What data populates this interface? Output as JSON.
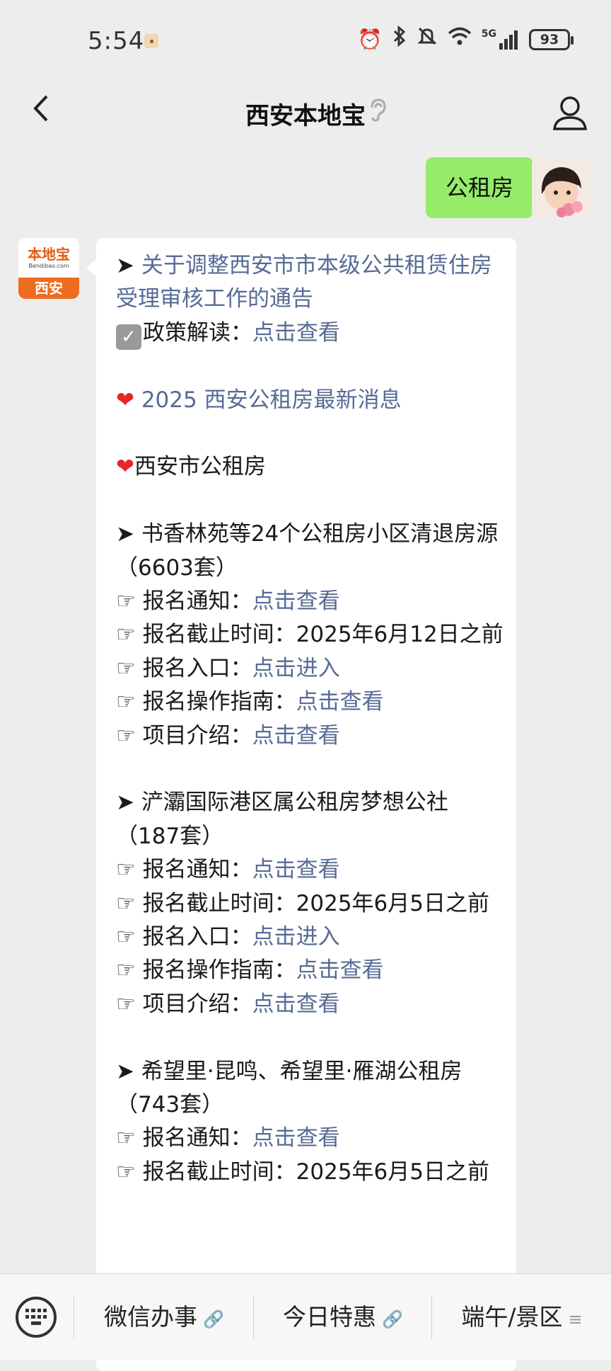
{
  "status_bar": {
    "time": "5:54",
    "network": "5G",
    "battery": "93"
  },
  "nav": {
    "title": "西安本地宝"
  },
  "chat": {
    "outgoing_text": "公租房",
    "bot_logo": {
      "name": "本地宝",
      "url": "Bendibao.com",
      "city": "西安"
    },
    "incoming": {
      "lines": [
        {
          "parts": [
            {
              "text": "➤ ",
              "style": "plain"
            },
            {
              "text": "关于调整西安市市本级公共租赁住房受理审核工作的通告",
              "style": "link"
            }
          ]
        },
        {
          "icon": "check",
          "parts": [
            {
              "text": "政策解读：",
              "style": "plain"
            },
            {
              "text": "点击查看",
              "style": "link"
            }
          ]
        },
        {
          "blank": true
        },
        {
          "icon": "heart",
          "parts": [
            {
              "text": " 2025 西安公租房最新消息",
              "style": "link"
            }
          ]
        },
        {
          "blank": true
        },
        {
          "icon": "heart",
          "parts": [
            {
              "text": "西安市公租房",
              "style": "plain"
            }
          ]
        },
        {
          "blank": true
        },
        {
          "parts": [
            {
              "text": "➤ 书香林苑等24个公租房小区清退房源（6603套）",
              "style": "plain"
            }
          ]
        },
        {
          "parts": [
            {
              "text": "☞ 报名通知：",
              "style": "plain"
            },
            {
              "text": "点击查看",
              "style": "link"
            }
          ]
        },
        {
          "parts": [
            {
              "text": "☞ 报名截止时间：2025年6月12日之前",
              "style": "plain"
            }
          ]
        },
        {
          "parts": [
            {
              "text": "☞ 报名入口：",
              "style": "plain"
            },
            {
              "text": "点击进入",
              "style": "link"
            }
          ]
        },
        {
          "parts": [
            {
              "text": "☞ 报名操作指南：",
              "style": "plain"
            },
            {
              "text": "点击查看",
              "style": "link"
            }
          ]
        },
        {
          "parts": [
            {
              "text": "☞ 项目介绍：",
              "style": "plain"
            },
            {
              "text": "点击查看",
              "style": "link"
            }
          ]
        },
        {
          "blank": true
        },
        {
          "parts": [
            {
              "text": "➤ 浐灞国际港区属公租房梦想公社（187套）",
              "style": "plain"
            }
          ]
        },
        {
          "parts": [
            {
              "text": "☞ 报名通知：",
              "style": "plain"
            },
            {
              "text": "点击查看",
              "style": "link"
            }
          ]
        },
        {
          "parts": [
            {
              "text": "☞ 报名截止时间：2025年6月5日之前",
              "style": "plain"
            }
          ]
        },
        {
          "parts": [
            {
              "text": "☞ 报名入口：",
              "style": "plain"
            },
            {
              "text": "点击进入",
              "style": "link"
            }
          ]
        },
        {
          "parts": [
            {
              "text": "☞ 报名操作指南：",
              "style": "plain"
            },
            {
              "text": "点击查看",
              "style": "link"
            }
          ]
        },
        {
          "parts": [
            {
              "text": "☞ 项目介绍：",
              "style": "plain"
            },
            {
              "text": "点击查看",
              "style": "link"
            }
          ]
        },
        {
          "blank": true
        },
        {
          "parts": [
            {
              "text": "➤ 希望里·昆鸣、希望里·雁湖公租房（743套）",
              "style": "plain"
            }
          ]
        },
        {
          "parts": [
            {
              "text": "☞ 报名通知：",
              "style": "plain"
            },
            {
              "text": "点击查看",
              "style": "link"
            }
          ]
        },
        {
          "parts": [
            {
              "text": "☞ 报名截止时间：2025年6月5日之前",
              "style": "plain"
            }
          ]
        }
      ]
    }
  },
  "bottom_menu": {
    "items": [
      {
        "label": "微信办事",
        "icon": "link-icon"
      },
      {
        "label": "今日特惠",
        "icon": "link-icon"
      },
      {
        "label": "端午/景区",
        "icon": "menu-lines-icon"
      }
    ]
  }
}
